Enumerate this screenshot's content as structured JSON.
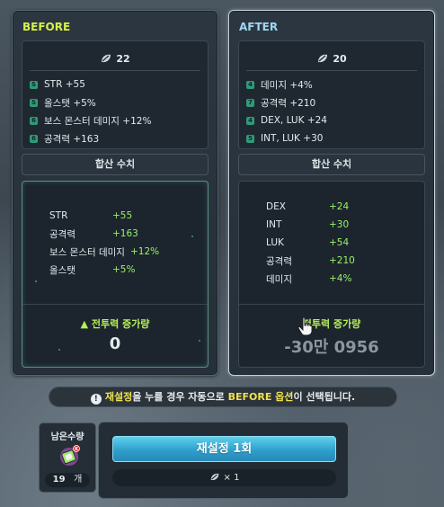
{
  "before": {
    "title": "BEFORE",
    "cube_count": "22",
    "options": [
      {
        "tier": "S",
        "text": "STR +55"
      },
      {
        "tier": "S",
        "text": "올스탯 +5%"
      },
      {
        "tier": "6",
        "text": "보스 몬스터 데미지 +12%"
      },
      {
        "tier": "6",
        "text": "공격력 +163"
      }
    ],
    "sum_header": "합산 수치",
    "stats": [
      {
        "key": "STR",
        "value": "+55"
      },
      {
        "key": "공격력",
        "value": "+163"
      },
      {
        "key": "보스 몬스터 데미지",
        "value": "+12%"
      },
      {
        "key": "올스탯",
        "value": "+5%"
      }
    ],
    "power_label": "▲ 전투력 증가량",
    "power_value": "0"
  },
  "after": {
    "title": "AFTER",
    "cube_count": "20",
    "options": [
      {
        "tier": "4",
        "text": "데미지 +4%"
      },
      {
        "tier": "7",
        "text": "공격력 +210"
      },
      {
        "tier": "4",
        "text": "DEX, LUK +24"
      },
      {
        "tier": "5",
        "text": "INT, LUK +30"
      }
    ],
    "sum_header": "합산 수치",
    "stats": [
      {
        "key": "DEX",
        "value": "+24"
      },
      {
        "key": "INT",
        "value": "+30"
      },
      {
        "key": "LUK",
        "value": "+54"
      },
      {
        "key": "공격력",
        "value": "+210"
      },
      {
        "key": "데미지",
        "value": "+4%"
      }
    ],
    "power_label": "전투력 증가량",
    "power_value": "-30만 0956"
  },
  "notice": {
    "pre": "재설정",
    "mid": "을 누를 경우 자동으로 ",
    "highlight": "BEFORE 옵션",
    "post": "이 선택됩니다."
  },
  "remain": {
    "label": "남은수량",
    "count": "19",
    "unit": "개"
  },
  "action": {
    "reset_label": "재설정 1회",
    "cost": "× 1"
  },
  "colors": {
    "before_title": "#d7f04a",
    "after_title": "#9fd6f0",
    "stat_value": "#9af26a",
    "button": "#3fb3dc"
  }
}
